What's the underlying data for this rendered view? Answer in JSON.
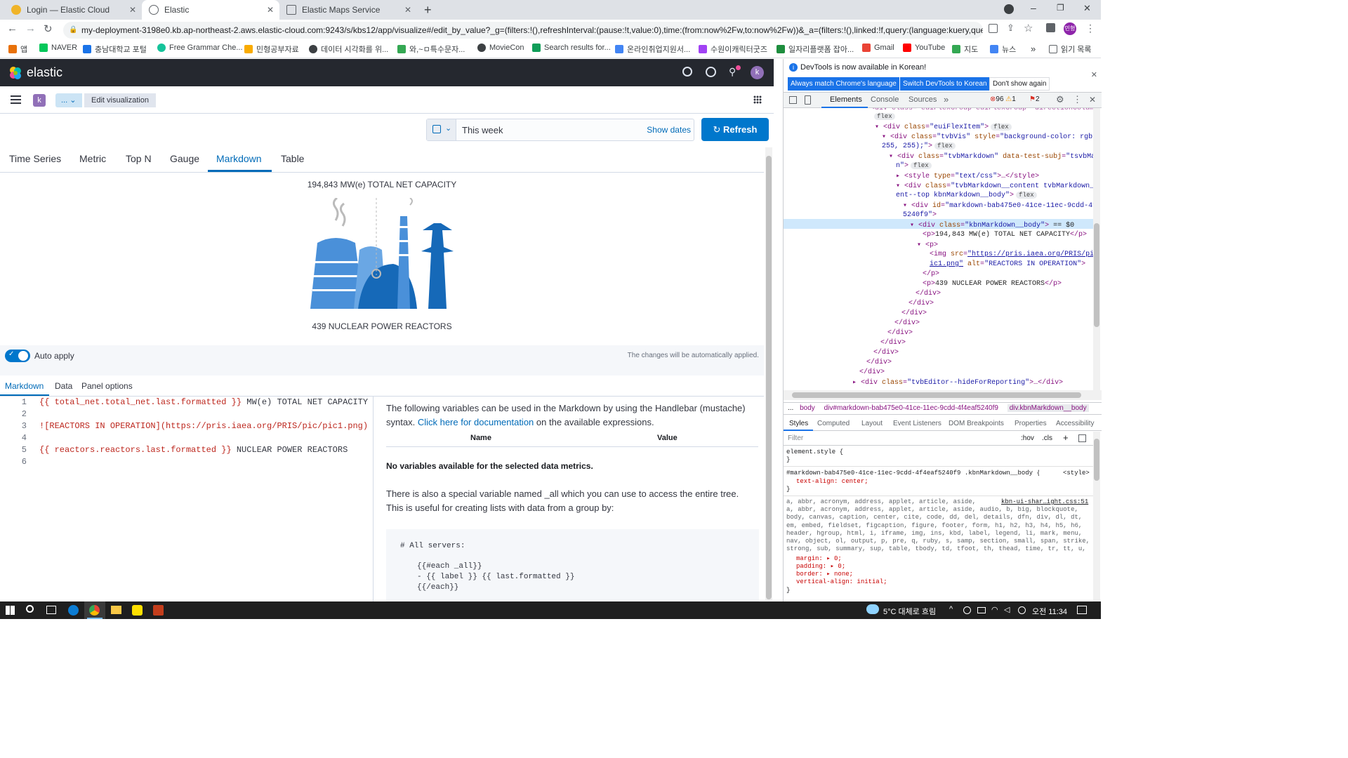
{
  "browser": {
    "tabs": [
      {
        "title": "Login — Elastic Cloud"
      },
      {
        "title": "Elastic"
      },
      {
        "title": "Elastic Maps Service"
      }
    ],
    "url": "my-deployment-3198e0.kb.ap-northeast-2.aws.elastic-cloud.com:9243/s/kbs12/app/visualize#/edit_by_value?_g=(filters:!(),refreshInterval:(pause:!t,value:0),time:(from:now%2Fw,to:now%2Fw))&_a=(filters:!(),linked:!f,query:(language:kuery,query:''),uiS...",
    "bookmarks": [
      "앱",
      "NAVER",
      "충남대학교 포털",
      "Free Grammar Che...",
      "민형공부자료",
      "데이터 시각화를 위...",
      "와,~ㅁ특수문자...",
      "MovieCon",
      "Search results for...",
      "온라인취업지원서...",
      "수원이캐릭터굿즈",
      "일자리플랫폼 잡아...",
      "Gmail",
      "YouTube",
      "지도",
      "뉴스"
    ],
    "bookmarks_more": "»",
    "reading_list": "읽기 목록",
    "profile": "민형"
  },
  "kibana": {
    "brand": "elastic",
    "avatar": "k",
    "space": "k",
    "breadcrumb_more": "...",
    "breadcrumb_current": "Edit visualization",
    "date_value": "This week",
    "show_dates": "Show dates",
    "refresh": "Refresh",
    "vis_tabs": [
      "Time Series",
      "Metric",
      "Top N",
      "Gauge",
      "Markdown",
      "Table"
    ],
    "preview": {
      "title_line": "194,843 MW(e) TOTAL NET CAPACITY",
      "image_alt": "REACTORS IN OPERATION",
      "bottom_line": "439 NUCLEAR POWER REACTORS"
    },
    "auto_apply": "Auto apply",
    "auto_apply_note": "The changes will be automatically applied.",
    "editor_tabs": [
      "Markdown",
      "Data",
      "Panel options"
    ],
    "code_lines": [
      {
        "n": "1",
        "text": "{{ total_net.total_net.last.formatted }}",
        "rest": " MW(e) TOTAL NET CAPACITY"
      },
      {
        "n": "2",
        "text": "",
        "rest": ""
      },
      {
        "n": "3",
        "text": "![REACTORS IN OPERATION](https://pris.iaea.org/PRIS/pic/pic1.png)",
        "rest": ""
      },
      {
        "n": "4",
        "text": "",
        "rest": ""
      },
      {
        "n": "5",
        "text": "{{ reactors.reactors.last.formatted }}",
        "rest": " NUCLEAR POWER REACTORS"
      },
      {
        "n": "6",
        "text": "",
        "rest": ""
      }
    ],
    "help": {
      "intro_a": "The following variables can be used in the Markdown by using the Handlebar (mustache) syntax.",
      "intro_link": "Click here for documentation",
      "intro_b": "on the available expressions.",
      "col_name": "Name",
      "col_value": "Value",
      "no_vars": "No variables available for the selected data metrics.",
      "all_note": "There is also a special variable named _all which you can use to access the entire tree. This is useful for creating lists with data from a group by:",
      "code": [
        "# All servers:",
        "",
        "{{#each _all}}",
        "- {{ label }} {{ last.formatted }}",
        "{{/each}}"
      ]
    }
  },
  "devtools": {
    "notice": "DevTools is now available in Korean!",
    "btn_match": "Always match Chrome's language",
    "btn_switch": "Switch DevTools to Korean",
    "btn_dont": "Don't show again",
    "tabs": [
      "Elements",
      "Console",
      "Sources"
    ],
    "errors": "96",
    "warnings": "1",
    "issues": "2",
    "breadcrumbs": [
      "...",
      "body",
      "div#markdown-bab475e0-41ce-11ec-9cdd-4f4eaf5240f9",
      "div.kbnMarkdown__body"
    ],
    "style_tabs": [
      "Styles",
      "Computed",
      "Layout",
      "Event Listeners",
      "DOM Breakpoints",
      "Properties",
      "Accessibility"
    ],
    "filter": "Filter",
    "hov": ":hov",
    "cls": ".cls",
    "rule1_selector": "element.style {",
    "rule2_selector": "#markdown-bab475e0-41ce-11ec-9cdd-4f4eaf5240f9 .kbnMarkdown__body {",
    "rule2_source": "<style>",
    "rule2_prop": "text-align: center;",
    "rule3_source": "kbn-ui-shar…ight.css:51",
    "rule3_selector": "a, abbr, acronym, address, applet, article, aside, audio, b, big, blockquote, body, canvas, caption, center, cite, code, dd, del, details, dfn, div, dl, dt, em, embed, fieldset, figcaption, figure, footer, form, h1, h2, h3, h4, h5, h6, header, hgroup, html, i, iframe, img, ins, kbd, label, legend, li, mark, menu, nav, object, ol, output, p, pre, q, ruby, s, samp, section, small, span, strike, strong, sub, summary, sup, table, tbody, td, tfoot, th, thead, time, tr, tt, u, ul, var, video {",
    "rule3_props": [
      "margin: ▸ 0;",
      "padding: ▸ 0;",
      "border: ▸ none;",
      "vertical-align: initial;"
    ]
  },
  "taskbar": {
    "weather": "5°C 대체로 흐림",
    "time": "오전 11:34"
  }
}
